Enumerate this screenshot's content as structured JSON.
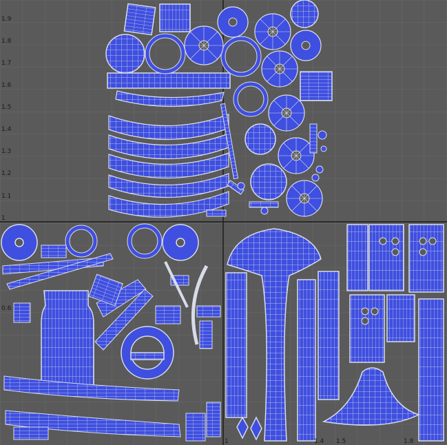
{
  "viewer": {
    "background_color": "#5a5a5a",
    "grid_color": "#6a6a6a",
    "tile_border_color": "#1c1c1c",
    "island_fill_color": "#3f4fe0",
    "island_wire_color": "#d8dce8",
    "tick_color": "#1a1a1a"
  },
  "axis": {
    "left_labels": [
      "1.9",
      "1.8",
      "1.7",
      "1.6",
      "1.5",
      "1.4",
      "1.3",
      "1.2",
      "1.1",
      "1",
      "0.6"
    ],
    "bottom_labels": [
      "1",
      "1.4",
      "1.5",
      "1.8"
    ]
  },
  "islands": {
    "top_tile": [
      "strap-island",
      "ring-island",
      "ring-island",
      "arc-strip-island"
    ],
    "bottom_left_tile": [
      "jar-island",
      "ring-island",
      "blade-strip-island"
    ],
    "bottom_right_tile": [
      "cap-island",
      "shaft-island",
      "panel-island",
      "fan-island"
    ]
  }
}
